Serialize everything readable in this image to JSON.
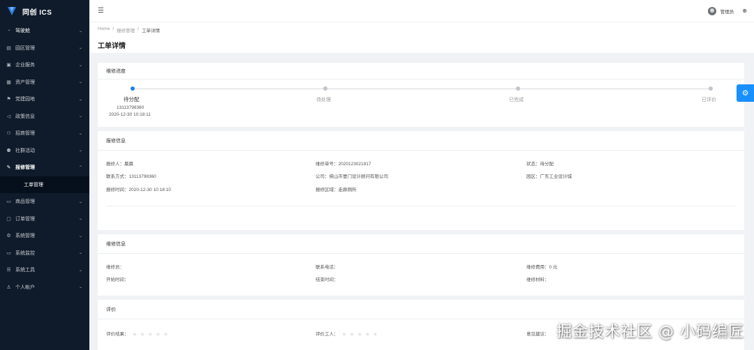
{
  "app": {
    "logo_text": "同创 ICS"
  },
  "sidebar": {
    "items": [
      {
        "label": "驾驶舱",
        "icon": "dashboard-icon"
      },
      {
        "label": "园区管理",
        "icon": "building-icon"
      },
      {
        "label": "企业服务",
        "icon": "briefcase-icon"
      },
      {
        "label": "资产管理",
        "icon": "asset-icon"
      },
      {
        "label": "党建园地",
        "icon": "flag-icon"
      },
      {
        "label": "政策信息",
        "icon": "megaphone-icon"
      },
      {
        "label": "招商管理",
        "icon": "people-icon"
      },
      {
        "label": "社群活动",
        "icon": "group-icon"
      },
      {
        "label": "报修管理",
        "icon": "wrench-icon"
      },
      {
        "label": "商品管理",
        "icon": "shop-icon"
      },
      {
        "label": "订单管理",
        "icon": "order-icon"
      },
      {
        "label": "系统管理",
        "icon": "gear-icon"
      },
      {
        "label": "系统监控",
        "icon": "monitor-icon"
      },
      {
        "label": "系统工具",
        "icon": "tools-icon"
      },
      {
        "label": "个人帐户",
        "icon": "user-icon"
      }
    ],
    "sub_item": "工单管理"
  },
  "header": {
    "user_name": "管理员"
  },
  "breadcrumb": {
    "home": "Home",
    "level1": "报修管理",
    "current": "工单详情",
    "sep": "/"
  },
  "page_title": "工单详情",
  "progress": {
    "title": "维修进度",
    "steps": [
      "待分配",
      "待处理",
      "已完成",
      "已评价"
    ],
    "phone": "13113798360",
    "time": "2020-12-30 10:18:11"
  },
  "repair_info": {
    "title": "报修信息",
    "reporter": "报修人：晨晨",
    "order_no": "维修单号：2020123021917",
    "status": "状态：待分配",
    "contact": "联系方式：13113798360",
    "company": "公司：佛山市壹门设计顾问有限公司",
    "park": "园区：广东工业设计城",
    "report_time": "报修时间：2020-12-30 10:18:10",
    "area": "报修区域：走廊厕所"
  },
  "maintenance_info": {
    "title": "维修信息",
    "worker": "维修员：",
    "phone": "联系电话：",
    "cost": "维修费用：0 元",
    "start": "开始时间：",
    "end": "结束时间：",
    "material": "维修材料："
  },
  "evaluation": {
    "title": "评价",
    "result": "评价结果：",
    "worker": "评价工人：",
    "opinion": "意见建议："
  },
  "watermark": "掘金技术社区 @ 小码编匠",
  "colors": {
    "sidebar_bg": "#0f1b2a",
    "accent": "#1890ff",
    "active_dot": "#1e7fe6"
  }
}
